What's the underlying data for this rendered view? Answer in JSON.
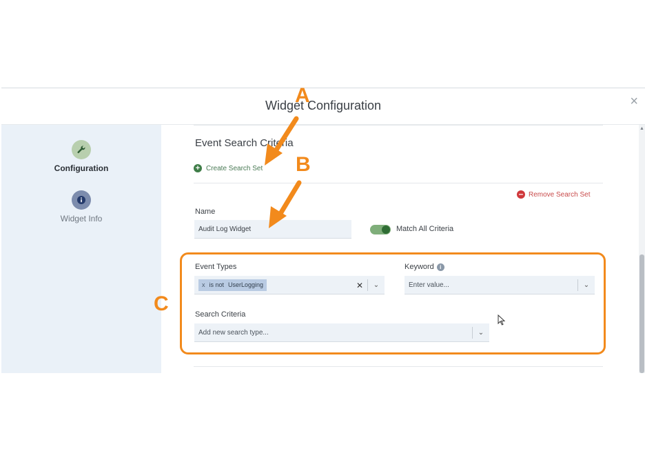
{
  "modal": {
    "title": "Widget Configuration",
    "close_glyph": "×"
  },
  "sidebar": {
    "items": [
      {
        "label": "Configuration",
        "icon": "wrench-icon",
        "active": true
      },
      {
        "label": "Widget Info",
        "icon": "info-icon",
        "active": false
      }
    ]
  },
  "main": {
    "section_title": "Event Search Criteria",
    "create_link": "Create Search Set",
    "remove_link": "Remove Search Set",
    "name_label": "Name",
    "name_value": "Audit Log Widget",
    "match_all_label": "Match All Criteria",
    "match_all_on": true,
    "event_types_label": "Event Types",
    "event_tag": {
      "remove_glyph": "x",
      "operator": "is not",
      "value": "UserLogging"
    },
    "clear_glyph": "✕",
    "keyword_label": "Keyword",
    "keyword_placeholder": "Enter value...",
    "search_criteria_label": "Search Criteria",
    "search_criteria_placeholder": "Add new search type..."
  },
  "annotations": {
    "a": "A",
    "b": "B",
    "c": "C",
    "color": "#f28a1c"
  },
  "colors": {
    "sidebar_bg": "#eaf1f8",
    "input_bg": "#edf2f7",
    "create_green": "#3f7d48",
    "remove_red": "#d0393c",
    "toggle_on": "#2f6d34",
    "tag_bg": "#b9cbe3"
  }
}
